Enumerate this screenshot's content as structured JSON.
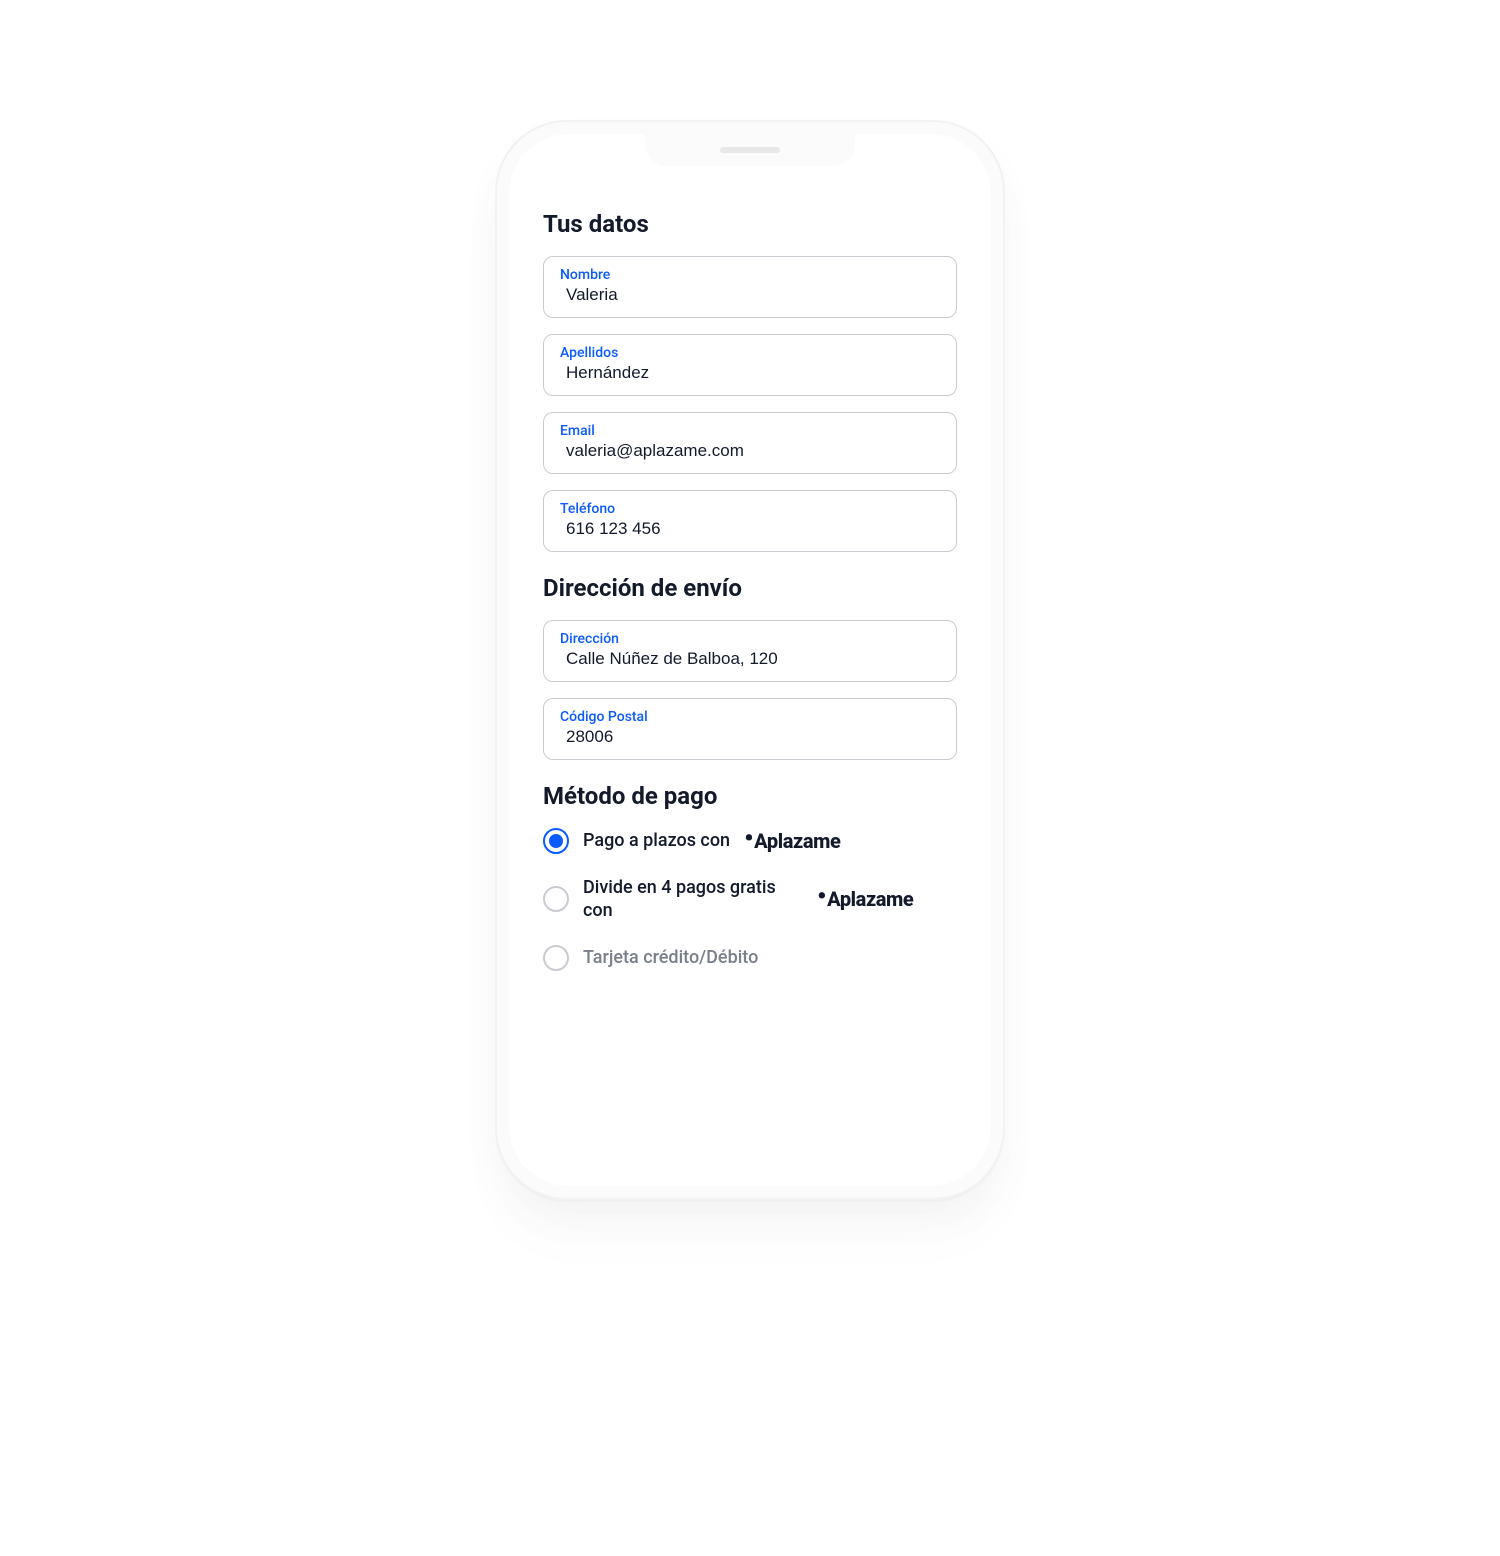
{
  "sections": {
    "personal": {
      "title": "Tus datos",
      "fields": {
        "name": {
          "label": "Nombre",
          "value": "Valeria"
        },
        "surname": {
          "label": "Apellidos",
          "value": "Hernández"
        },
        "email": {
          "label": "Email",
          "value": "valeria@aplazame.com"
        },
        "phone": {
          "label": "Teléfono",
          "value": "616 123 456"
        }
      }
    },
    "shipping": {
      "title": "Dirección de envío",
      "fields": {
        "address": {
          "label": "Dirección",
          "value": "Calle Núñez de Balboa, 120"
        },
        "postal": {
          "label": "Código Postal",
          "value": "28006"
        }
      }
    },
    "payment": {
      "title": "Método de pago",
      "options": {
        "installments": {
          "label": "Pago a plazos con",
          "brand": "Aplazame",
          "selected": true
        },
        "split4": {
          "label": "Divide en 4 pagos gratis con",
          "brand": "Aplazame",
          "selected": false
        },
        "card": {
          "label": "Tarjeta crédito/Débito",
          "selected": false
        }
      }
    }
  },
  "colors": {
    "accent": "#0b5cff",
    "text": "#131a2c",
    "muted": "#7a7f8c",
    "border": "#c9cbd1"
  }
}
